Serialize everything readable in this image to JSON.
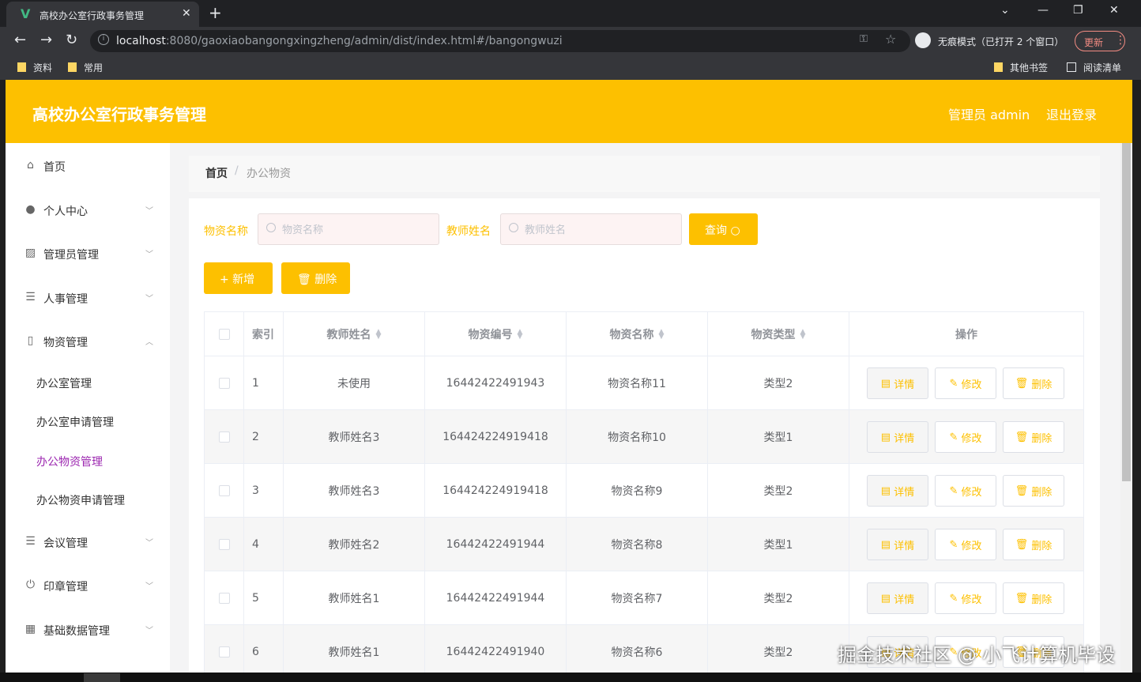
{
  "browser": {
    "tab_title": "高校办公室行政事务管理",
    "tab_logo": "V",
    "tab_close": "✕",
    "newtab": "+",
    "win_min": "—",
    "win_restore": "❐",
    "win_close": "✕",
    "win_dropdown": "⌄",
    "back": "←",
    "forward": "→",
    "reload": "↻",
    "url_host": "localhost",
    "url_rest": ":8080/gaoxiaobangongxingzheng/admin/dist/index.html#/bangongwuzi",
    "incognito_text": "无痕模式（已打开 2 个窗口）",
    "update_label": "更新",
    "menu_dots": "⋮",
    "bookmarks": [
      {
        "label": "资料"
      },
      {
        "label": "常用"
      }
    ],
    "other_bookmarks": "其他书签",
    "reading_list": "阅读清单"
  },
  "header": {
    "brand": "高校办公室行政事务管理",
    "admin_label": "管理员 admin",
    "logout_label": "退出登录",
    "brand_color": "#fdc000"
  },
  "sidebar": {
    "items": [
      {
        "label": "首页",
        "icon": "home-icon"
      },
      {
        "label": "个人中心",
        "icon": "user-icon"
      },
      {
        "label": "管理员管理",
        "icon": "chart-icon"
      },
      {
        "label": "人事管理",
        "icon": "list-icon"
      },
      {
        "label": "物资管理",
        "icon": "document-icon"
      },
      {
        "label": "会议管理",
        "icon": "list-icon"
      },
      {
        "label": "印章管理",
        "icon": "power-icon"
      },
      {
        "label": "基础数据管理",
        "icon": "grid-icon"
      }
    ],
    "sub_items": [
      {
        "label": "办公室管理"
      },
      {
        "label": "办公室申请管理"
      },
      {
        "label": "办公物资管理",
        "active": true
      },
      {
        "label": "办公物资申请管理"
      }
    ],
    "active_color": "#9c27b0"
  },
  "breadcrumb": {
    "home": "首页",
    "separator": "/",
    "current": "办公物资"
  },
  "search": {
    "label1": "物资名称",
    "placeholder1": "物资名称",
    "label2": "教师姓名",
    "placeholder2": "教师姓名",
    "query_button": "查询"
  },
  "actions": {
    "add_label": "+ 新增",
    "delete_label": "删除"
  },
  "table": {
    "columns": [
      "索引",
      "教师姓名",
      "物资编号",
      "物资名称",
      "物资类型",
      "操作"
    ],
    "op_labels": {
      "detail": "详情",
      "edit": "修改",
      "delete": "删除"
    },
    "rows": [
      {
        "index": "1",
        "teacher": "未使用",
        "code": "16442422491943",
        "name": "物资名称11",
        "type": "类型2"
      },
      {
        "index": "2",
        "teacher": "教师姓名3",
        "code": "164424224919418",
        "name": "物资名称10",
        "type": "类型1"
      },
      {
        "index": "3",
        "teacher": "教师姓名3",
        "code": "164424224919418",
        "name": "物资名称9",
        "type": "类型2"
      },
      {
        "index": "4",
        "teacher": "教师姓名2",
        "code": "16442422491944",
        "name": "物资名称8",
        "type": "类型1"
      },
      {
        "index": "5",
        "teacher": "教师姓名1",
        "code": "16442422491944",
        "name": "物资名称7",
        "type": "类型2"
      },
      {
        "index": "6",
        "teacher": "教师姓名1",
        "code": "16442422491940",
        "name": "物资名称6",
        "type": "类型2"
      }
    ]
  },
  "watermark": "掘金技术社区 @ 小飞计算机毕设"
}
